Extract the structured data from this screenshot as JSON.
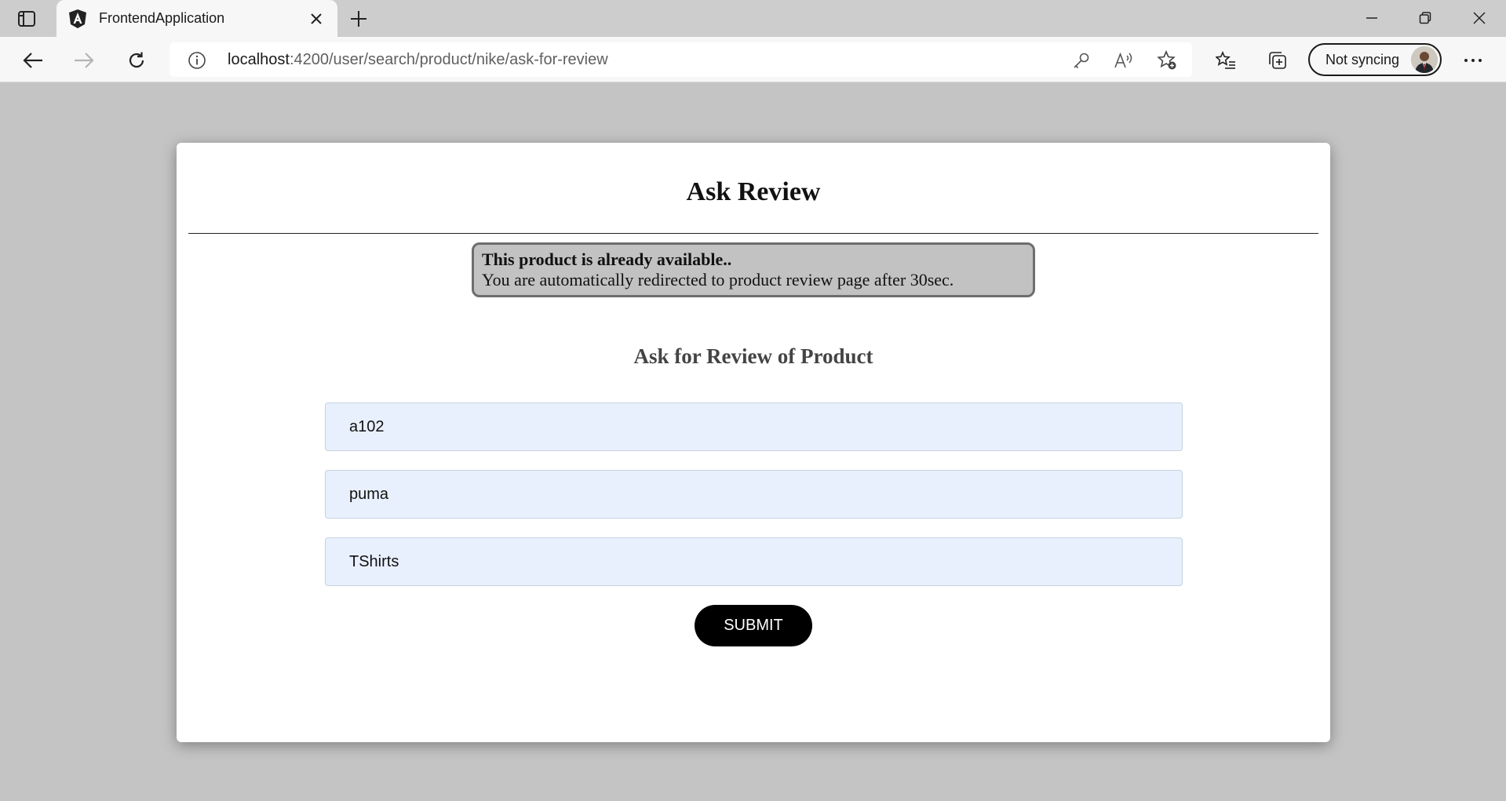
{
  "browser": {
    "tab": {
      "title": "FrontendApplication",
      "favicon": "angular-icon"
    },
    "address_bar": {
      "host": "localhost",
      "path": ":4200/user/search/product/nike/ask-for-review"
    },
    "profile": {
      "label": "Not syncing"
    }
  },
  "page": {
    "title": "Ask Review",
    "alert": {
      "title": "This product is already available..",
      "message": "You are automatically redirected to product review page after 30sec."
    },
    "form": {
      "title": "Ask for Review of Product",
      "fields": [
        {
          "value": "a102"
        },
        {
          "value": "puma"
        },
        {
          "value": "TShirts"
        }
      ],
      "submit_label": "SUBMIT"
    }
  },
  "colors": {
    "page_background": "#c4c4c4",
    "alert_background": "#c2c2c2",
    "input_background": "#e8f0fe",
    "button": "#000000"
  }
}
